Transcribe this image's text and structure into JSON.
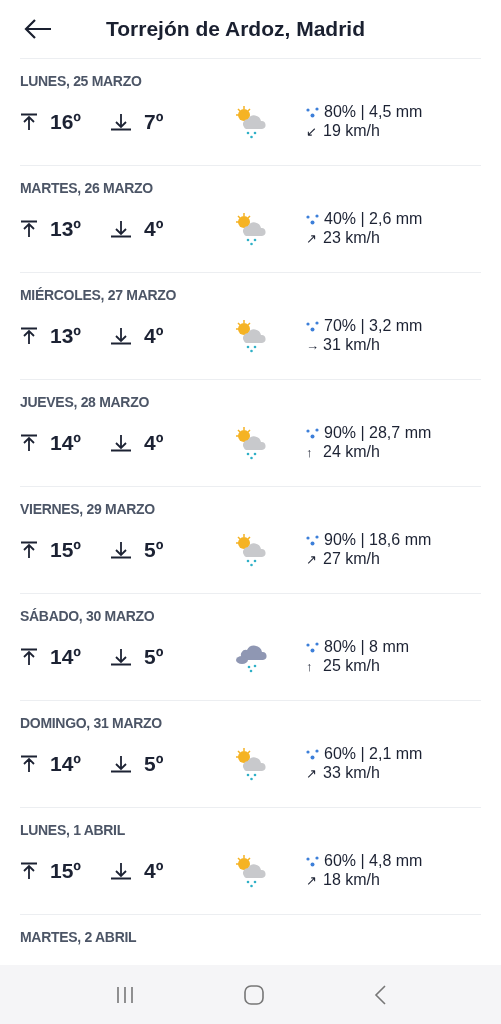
{
  "header": {
    "title": "Torrejón de Ardoz, Madrid"
  },
  "days": [
    {
      "date": "LUNES, 25 MARZO",
      "max": "16º",
      "min": "7º",
      "sky": {
        "kind": "sun-cloud-rain"
      },
      "rain": "80% | 4,5 mm",
      "wind_arrow": "↙",
      "wind": "19 km/h"
    },
    {
      "date": "MARTES, 26 MARZO",
      "max": "13º",
      "min": "4º",
      "sky": {
        "kind": "sun-cloud-rain"
      },
      "rain": "40% | 2,6 mm",
      "wind_arrow": "↗",
      "wind": "23 km/h"
    },
    {
      "date": "MIÉRCOLES, 27 MARZO",
      "max": "13º",
      "min": "4º",
      "sky": {
        "kind": "sun-cloud-rain"
      },
      "rain": "70% | 3,2 mm",
      "wind_arrow": "→",
      "wind": "31 km/h"
    },
    {
      "date": "JUEVES, 28 MARZO",
      "max": "14º",
      "min": "4º",
      "sky": {
        "kind": "sun-cloud-rain"
      },
      "rain": "90% | 28,7 mm",
      "wind_arrow": "↑",
      "wind": "24 km/h"
    },
    {
      "date": "VIERNES, 29 MARZO",
      "max": "15º",
      "min": "5º",
      "sky": {
        "kind": "sun-cloud-rain"
      },
      "rain": "90% | 18,6 mm",
      "wind_arrow": "↗",
      "wind": "27 km/h"
    },
    {
      "date": "SÁBADO, 30 MARZO",
      "max": "14º",
      "min": "5º",
      "sky": {
        "kind": "cloud-rain"
      },
      "rain": "80% | 8 mm",
      "wind_arrow": "↑",
      "wind": "25 km/h"
    },
    {
      "date": "DOMINGO, 31 MARZO",
      "max": "14º",
      "min": "5º",
      "sky": {
        "kind": "sun-cloud-rain"
      },
      "rain": "60% | 2,1 mm",
      "wind_arrow": "↗",
      "wind": "33 km/h"
    },
    {
      "date": "LUNES, 1 ABRIL",
      "max": "15º",
      "min": "4º",
      "sky": {
        "kind": "sun-cloud-rain"
      },
      "rain": "60% | 4,8 mm",
      "wind_arrow": "↗",
      "wind": "18 km/h"
    },
    {
      "date": "MARTES, 2 ABRIL"
    }
  ]
}
